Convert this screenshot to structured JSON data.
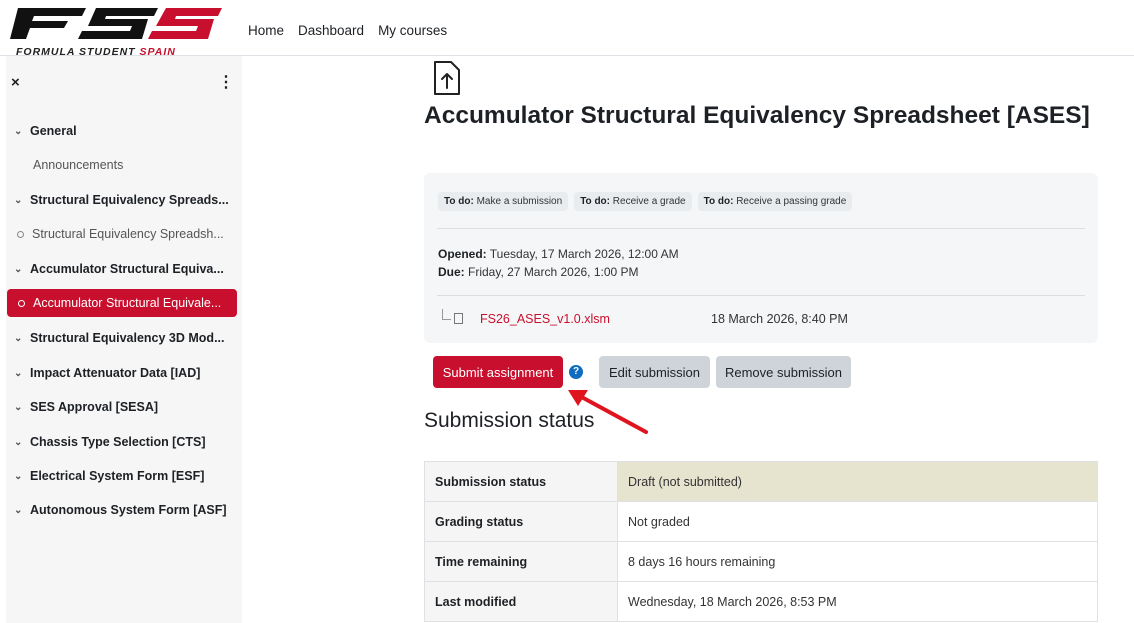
{
  "brand": {
    "logo_letters": "FSS",
    "tagline_main": "FORMULA STUDENT",
    "tagline_accent": "SPAIN",
    "accent_color": "#c8102e"
  },
  "nav": {
    "items": [
      "Home",
      "Dashboard",
      "My courses"
    ]
  },
  "sidebar": {
    "close_glyph": "×",
    "more_glyph": "⋮",
    "items": [
      {
        "label": "General",
        "kind": "section"
      },
      {
        "label": "Announcements",
        "kind": "plain"
      },
      {
        "label": "Structural Equivalency Spreads...",
        "kind": "section"
      },
      {
        "label": "Structural Equivalency Spreadsh...",
        "kind": "sub"
      },
      {
        "label": "Accumulator Structural Equiva...",
        "kind": "section"
      },
      {
        "label": "Accumulator Structural Equivale...",
        "kind": "sub-active"
      },
      {
        "label": "Structural Equivalency 3D Mod...",
        "kind": "section"
      },
      {
        "label": "Impact Attenuator Data [IAD]",
        "kind": "section"
      },
      {
        "label": "SES Approval [SESA]",
        "kind": "section"
      },
      {
        "label": "Chassis Type Selection [CTS]",
        "kind": "section"
      },
      {
        "label": "Electrical System Form [ESF]",
        "kind": "section"
      },
      {
        "label": "Autonomous System Form [ASF]",
        "kind": "section"
      }
    ]
  },
  "main": {
    "title": "Accumulator Structural Equivalency Spreadsheet [ASES]",
    "todos": [
      {
        "prefix": "To do:",
        "text": "Make a submission"
      },
      {
        "prefix": "To do:",
        "text": "Receive a grade"
      },
      {
        "prefix": "To do:",
        "text": "Receive a passing grade"
      }
    ],
    "opened_label": "Opened:",
    "opened_value": "Tuesday, 17 March 2026, 12:00 AM",
    "due_label": "Due:",
    "due_value": "Friday, 27 March 2026, 1:00 PM",
    "file_name": "FS26_ASES_v1.0.xlsm",
    "file_date": "18 March 2026, 8:40 PM",
    "buttons": {
      "submit": "Submit assignment",
      "help": "?",
      "edit": "Edit submission",
      "remove": "Remove submission"
    },
    "submission_heading": "Submission status",
    "status_rows": [
      {
        "key": "Submission status",
        "value": "Draft (not submitted)",
        "highlight": true
      },
      {
        "key": "Grading status",
        "value": "Not graded"
      },
      {
        "key": "Time remaining",
        "value": "8 days 16 hours remaining"
      },
      {
        "key": "Last modified",
        "value": "Wednesday, 18 March 2026, 8:53 PM"
      }
    ]
  },
  "annotation": {
    "arrow_color": "#e0141e",
    "points_to": "submit-assignment-button"
  }
}
